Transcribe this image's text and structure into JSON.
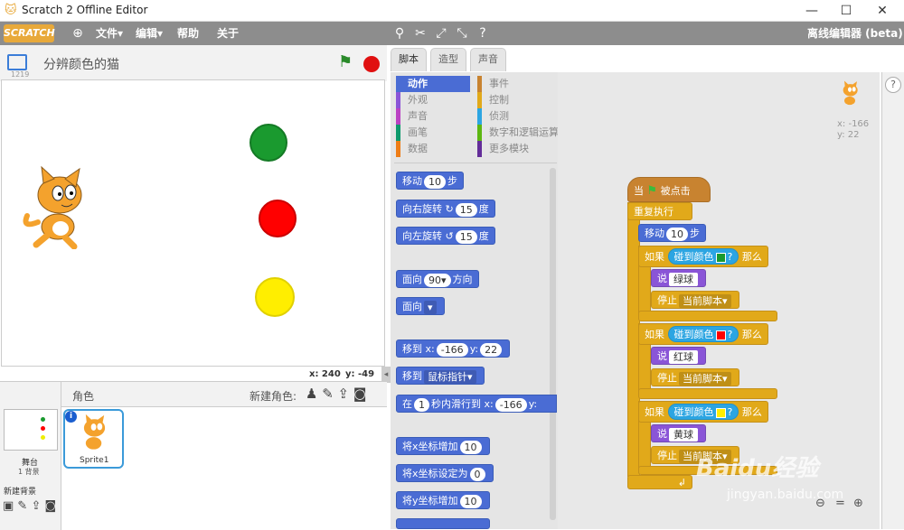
{
  "window": {
    "title": "Scratch 2 Offline Editor",
    "minimize": "—",
    "maximize": "☐",
    "close": "✕"
  },
  "menubar": {
    "logo": "SCRATCH",
    "file": "文件▾",
    "edit": "编辑▾",
    "help": "帮助",
    "about": "关于",
    "mode": "离线编辑器 (beta)"
  },
  "stage": {
    "project_name": "分辨颜色的猫",
    "version": "1219",
    "coords_x": "x: 240",
    "coords_y": "y: -49"
  },
  "sprites": {
    "header": "角色",
    "new_sprite": "新建角色:",
    "stage_label": "舞台",
    "backdrop_count": "1 背景",
    "new_backdrop": "新建背景",
    "sprite_name": "Sprite1"
  },
  "tabs": [
    "脚本",
    "造型",
    "声音"
  ],
  "categories_left": [
    "动作",
    "外观",
    "声音",
    "画笔",
    "数据"
  ],
  "categories_right": [
    "事件",
    "控制",
    "侦测",
    "数字和逻辑运算",
    "更多模块"
  ],
  "palette": {
    "move": "移动",
    "move_val": "10",
    "steps": "步",
    "turn_right": "向右旋转",
    "turn_right_val": "15",
    "deg": "度",
    "turn_left": "向左旋转",
    "turn_left_val": "15",
    "point_dir": "面向",
    "point_dir_val": "90▾",
    "dir": "方向",
    "point_towards": "面向",
    "goto_xy": "移到 x:",
    "goto_x": "-166",
    "goto_y_label": "y:",
    "goto_y": "22",
    "goto": "移到",
    "goto_target": "鼠标指针▾",
    "glide": "在",
    "glide_secs": "1",
    "glide_text": "秒内滑行到 x:",
    "glide_x": "-166",
    "glide_y": "y:",
    "change_x": "将x坐标增加",
    "change_x_val": "10",
    "set_x": "将x坐标设定为",
    "set_x_val": "0",
    "change_y": "将y坐标增加",
    "change_y_val": "10"
  },
  "script": {
    "hat_when": "当",
    "hat_clicked": "被点击",
    "forever": "重复执行",
    "move": "移动",
    "move_val": "10",
    "steps": "步",
    "if": "如果",
    "touching": "碰到颜色",
    "q": "?",
    "then": "那么",
    "say": "说",
    "stop": "停止",
    "stop_opt": "当前脚本▾",
    "green": "绿球",
    "red": "红球",
    "yellow": "黄球",
    "loop_arrow": "↲"
  },
  "sprite_info": {
    "x": "x: -166",
    "y": "y: 22"
  },
  "colors": {
    "green": "#1a9a2f",
    "red": "#ff0000",
    "yellow": "#ffee00"
  },
  "watermark": {
    "text": "Baidu经验",
    "url": "jingyan.baidu.com"
  }
}
